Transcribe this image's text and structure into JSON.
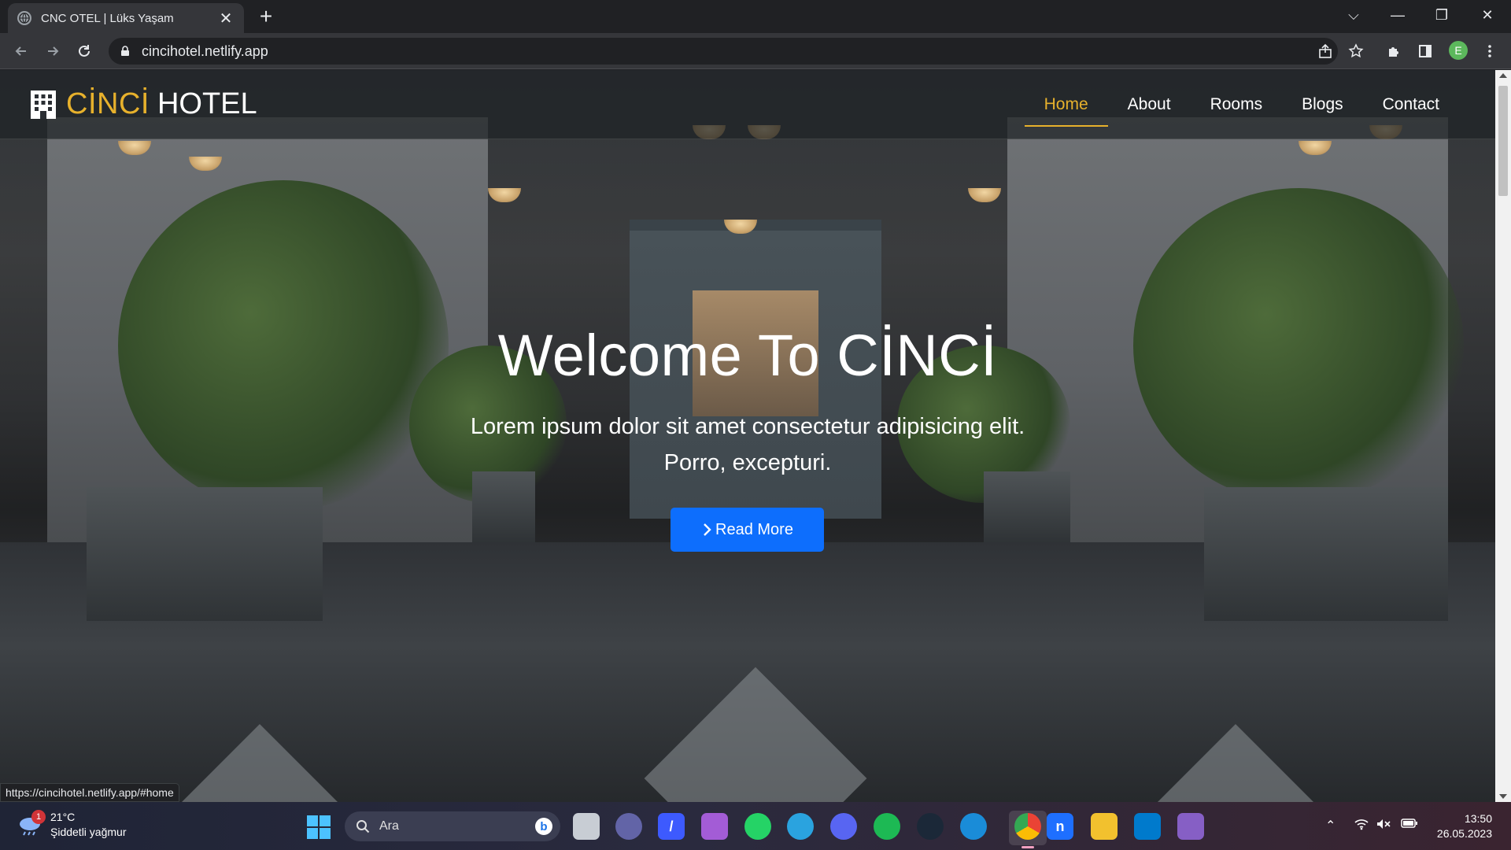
{
  "browser": {
    "tab_title": "CNC OTEL | Lüks Yaşam",
    "tab_close": "✕",
    "new_tab": "+",
    "url": "cincihotel.netlify.app",
    "profile_initial": "E",
    "status_url": "https://cincihotel.netlify.app/#home"
  },
  "site": {
    "brand_part1": "CİNCİ",
    "brand_part2": "HOTEL",
    "brand_color": "#e7b12c",
    "nav": [
      {
        "label": "Home",
        "active": true
      },
      {
        "label": "About",
        "active": false
      },
      {
        "label": "Rooms",
        "active": false
      },
      {
        "label": "Blogs",
        "active": false
      },
      {
        "label": "Contact",
        "active": false
      }
    ],
    "hero": {
      "title": "Welcome To CİNCİ",
      "subtitle_line1": "Lorem ipsum dolor sit amet consectetur adipisicing elit.",
      "subtitle_line2": "Porro, excepturi.",
      "cta_label": "Read More",
      "cta_icon": "chevron-right-icon",
      "cta_color": "#0d6efd"
    }
  },
  "taskbar": {
    "weather_temp": "21°C",
    "weather_desc": "Şiddetli yağmur",
    "weather_badge": "1",
    "search_placeholder": "Ara",
    "apps": [
      "task-view",
      "teams-meet",
      "linear",
      "files",
      "whatsapp",
      "telegram",
      "discord",
      "spotify",
      "steam",
      "edge",
      "chrome",
      "notion",
      "sticky",
      "vscode",
      "visual-studio"
    ],
    "time": "13:50",
    "date": "26.05.2023"
  }
}
